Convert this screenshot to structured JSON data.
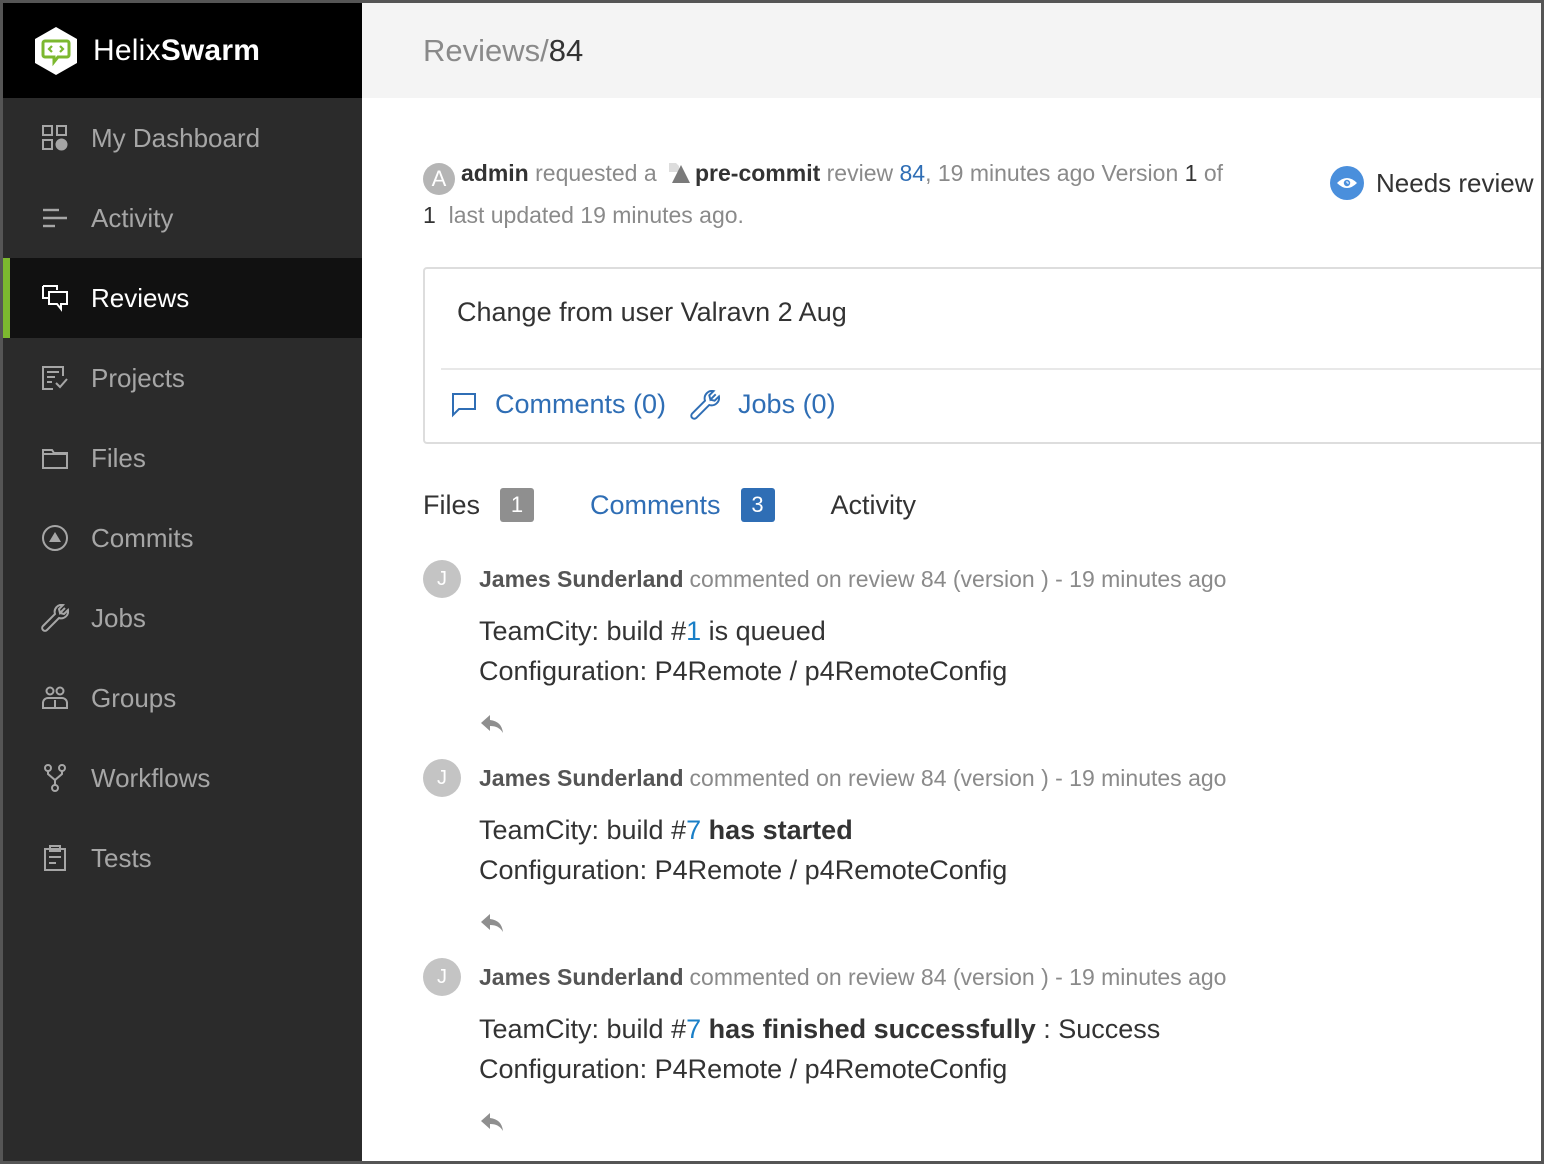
{
  "brand": {
    "light": "Helix",
    "bold": "Swarm",
    "accent_color": "#7cb82f"
  },
  "sidebar": {
    "items": [
      {
        "label": "My Dashboard",
        "icon": "dashboard-icon",
        "active": false
      },
      {
        "label": "Activity",
        "icon": "activity-icon",
        "active": false
      },
      {
        "label": "Reviews",
        "icon": "reviews-icon",
        "active": true
      },
      {
        "label": "Projects",
        "icon": "projects-icon",
        "active": false
      },
      {
        "label": "Files",
        "icon": "folder-icon",
        "active": false
      },
      {
        "label": "Commits",
        "icon": "commits-icon",
        "active": false
      },
      {
        "label": "Jobs",
        "icon": "wrench-icon",
        "active": false
      },
      {
        "label": "Groups",
        "icon": "groups-icon",
        "active": false
      },
      {
        "label": "Workflows",
        "icon": "workflows-icon",
        "active": false
      },
      {
        "label": "Tests",
        "icon": "tests-icon",
        "active": false
      }
    ]
  },
  "header": {
    "crumb": "Reviews/",
    "review_id": "84"
  },
  "summary": {
    "avatar_initial": "A",
    "author": "admin",
    "requested_a": "requested a",
    "type": "pre-commit",
    "review_word": "review",
    "review_id": "84",
    "after_id": ", 19 minutes ago Version",
    "version": "1",
    "of_word": "of",
    "version_total": "1",
    "updated": "last updated 19 minutes ago."
  },
  "status": {
    "label": "Needs review",
    "color": "#4a8fdc"
  },
  "description": {
    "text": "Change from user Valravn 2 Aug",
    "comments_link": "Comments (0)",
    "jobs_link": "Jobs (0)"
  },
  "tabs": [
    {
      "label": "Files",
      "count": "1",
      "active": false
    },
    {
      "label": "Comments",
      "count": "3",
      "active": true
    },
    {
      "label": "Activity",
      "count": null,
      "active": false
    }
  ],
  "comments": [
    {
      "initial": "J",
      "author": "James Sunderland",
      "meta": "commented on review 84 (version ) - 19 minutes ago",
      "prefix": "TeamCity: build #",
      "build": "1",
      "status_bold": "",
      "status_plain": " is queued",
      "suffix": "",
      "config": "Configuration: P4Remote / p4RemoteConfig"
    },
    {
      "initial": "J",
      "author": "James Sunderland",
      "meta": "commented on review 84 (version ) - 19 minutes ago",
      "prefix": "TeamCity: build #",
      "build": "7",
      "status_bold": " has started",
      "status_plain": "",
      "suffix": "",
      "config": "Configuration: P4Remote / p4RemoteConfig"
    },
    {
      "initial": "J",
      "author": "James Sunderland",
      "meta": "commented on review 84 (version ) - 19 minutes ago",
      "prefix": "TeamCity: build #",
      "build": "7",
      "status_bold": " has finished successfully",
      "status_plain": "",
      "suffix": " : Success",
      "config": "Configuration: P4Remote / p4RemoteConfig"
    }
  ]
}
